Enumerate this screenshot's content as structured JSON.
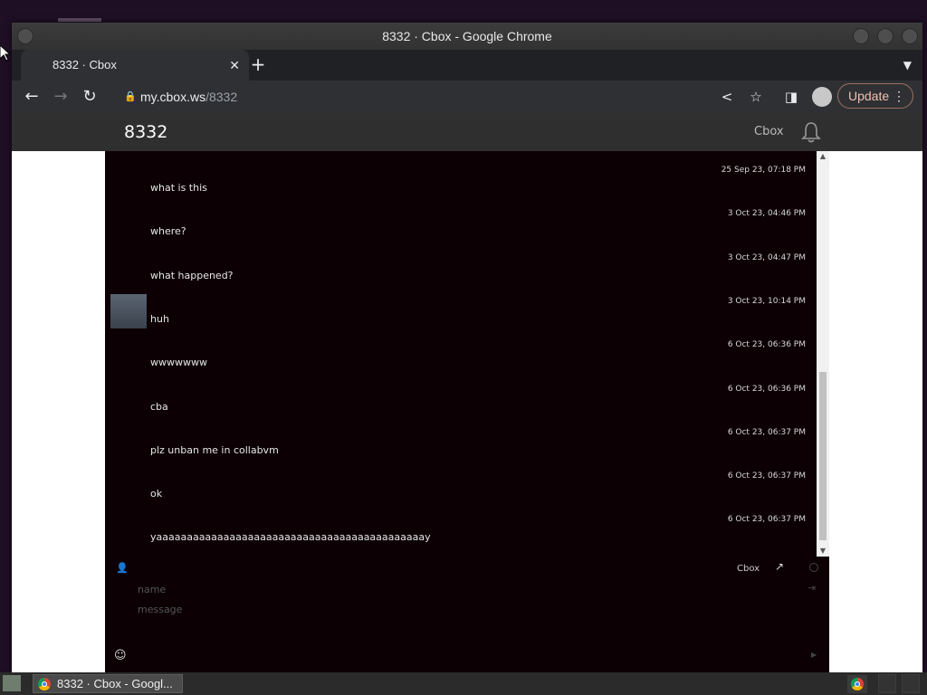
{
  "window": {
    "title": "8332 · Cbox - Google Chrome"
  },
  "browser": {
    "tab_title": "8332 · Cbox",
    "url_host": "my.cbox.ws",
    "url_path": "/8332",
    "update_label": "Update"
  },
  "app": {
    "title": "8332",
    "link": "Cbox"
  },
  "messages": [
    {
      "name": "",
      "text": "what is this",
      "time": "25 Sep 23, 07:18 PM",
      "avatar": false
    },
    {
      "name": "",
      "text": "where?",
      "time": "3 Oct 23, 04:46 PM",
      "avatar": false
    },
    {
      "name": "",
      "text": "what happened?",
      "time": "3 Oct 23, 04:47 PM",
      "avatar": false
    },
    {
      "name": "",
      "text": "huh",
      "time": "3 Oct 23, 10:14 PM",
      "avatar": true
    },
    {
      "name": "",
      "text": "wwwwwww",
      "time": "6 Oct 23, 06:36 PM",
      "avatar": false
    },
    {
      "name": "",
      "text": "cba",
      "time": "6 Oct 23, 06:36 PM",
      "avatar": false
    },
    {
      "name": "",
      "text": "plz unban me in collabvm",
      "time": "6 Oct 23, 06:37 PM",
      "avatar": false
    },
    {
      "name": "",
      "text": "ok",
      "time": "6 Oct 23, 06:37 PM",
      "avatar": false
    },
    {
      "name": "",
      "text": "yaaaaaaaaaaaaaaaaaaaaaaaaaaaaaaaaaaaaaaaaaaaay",
      "time": "6 Oct 23, 06:37 PM",
      "avatar": false
    }
  ],
  "composer": {
    "brand": "Cbox",
    "name_placeholder": "name",
    "message_placeholder": "message"
  },
  "taskbar": {
    "task_label": "8332 · Cbox - Googl..."
  },
  "colors": {
    "chat_bg": "#0c0004",
    "username": "#2a2a9e",
    "update_accent": "#f0c0b0"
  }
}
